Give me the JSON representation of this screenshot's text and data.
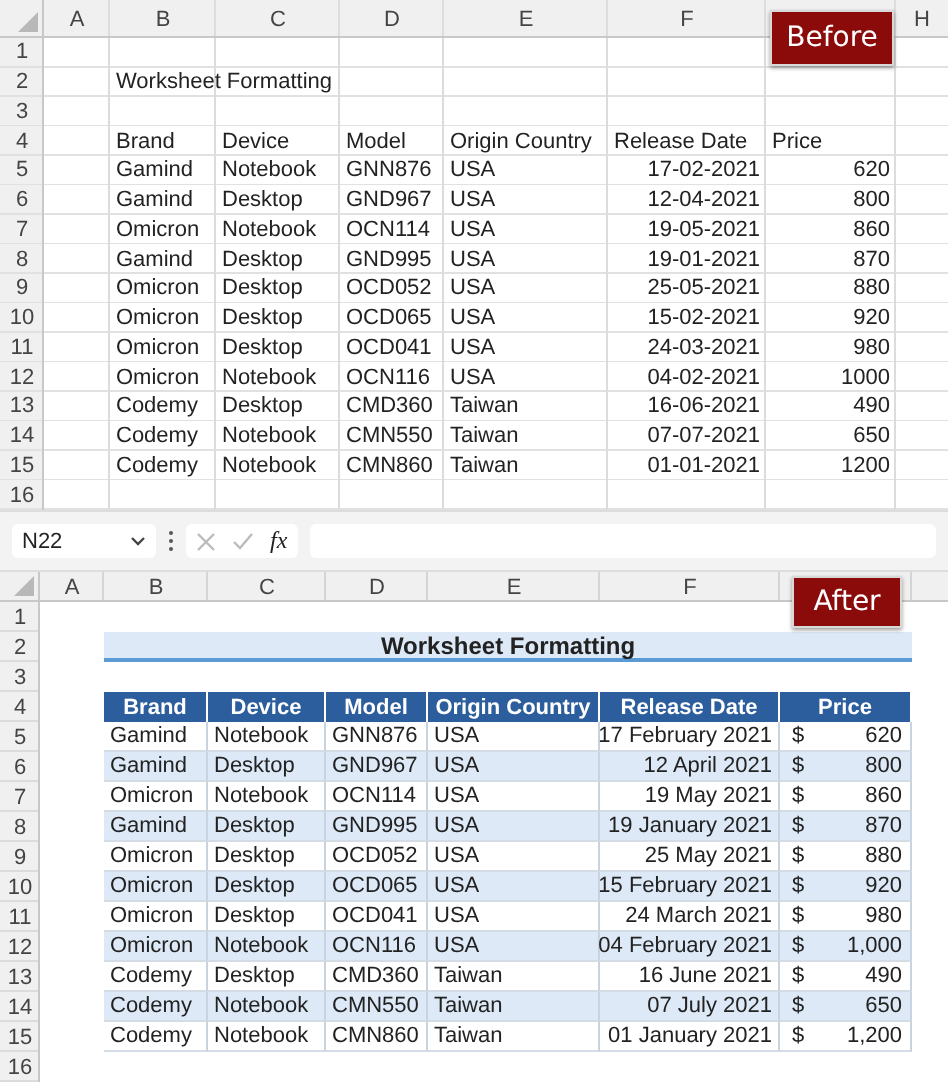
{
  "before": {
    "badge": "Before",
    "column_letters": [
      "A",
      "B",
      "C",
      "D",
      "E",
      "F",
      "H"
    ],
    "row_numbers": [
      "1",
      "2",
      "3",
      "4",
      "5",
      "6",
      "7",
      "8",
      "9",
      "10",
      "11",
      "12",
      "13",
      "14",
      "15",
      "16"
    ],
    "title": "Worksheet Formatting",
    "headers": [
      "Brand",
      "Device",
      "Model",
      "Origin Country",
      "Release Date",
      "Price"
    ],
    "rows": [
      [
        "Gamind",
        "Notebook",
        "GNN876",
        "USA",
        "17-02-2021",
        "620"
      ],
      [
        "Gamind",
        "Desktop",
        "GND967",
        "USA",
        "12-04-2021",
        "800"
      ],
      [
        "Omicron",
        "Notebook",
        "OCN114",
        "USA",
        "19-05-2021",
        "860"
      ],
      [
        "Gamind",
        "Desktop",
        "GND995",
        "USA",
        "19-01-2021",
        "870"
      ],
      [
        "Omicron",
        "Desktop",
        "OCD052",
        "USA",
        "25-05-2021",
        "880"
      ],
      [
        "Omicron",
        "Desktop",
        "OCD065",
        "USA",
        "15-02-2021",
        "920"
      ],
      [
        "Omicron",
        "Desktop",
        "OCD041",
        "USA",
        "24-03-2021",
        "980"
      ],
      [
        "Omicron",
        "Notebook",
        "OCN116",
        "USA",
        "04-02-2021",
        "1000"
      ],
      [
        "Codemy",
        "Desktop",
        "CMD360",
        "Taiwan",
        "16-06-2021",
        "490"
      ],
      [
        "Codemy",
        "Notebook",
        "CMN550",
        "Taiwan",
        "07-07-2021",
        "650"
      ],
      [
        "Codemy",
        "Notebook",
        "CMN860",
        "Taiwan",
        "01-01-2021",
        "1200"
      ]
    ]
  },
  "formula_bar": {
    "name_box": "N22",
    "function_label": "fx"
  },
  "after": {
    "badge": "After",
    "column_letters": [
      "A",
      "B",
      "C",
      "D",
      "E",
      "F"
    ],
    "row_numbers": [
      "1",
      "2",
      "3",
      "4",
      "5",
      "6",
      "7",
      "8",
      "9",
      "10",
      "11",
      "12",
      "13",
      "14",
      "15",
      "16"
    ],
    "title": "Worksheet Formatting",
    "headers": [
      "Brand",
      "Device",
      "Model",
      "Origin Country",
      "Release Date",
      "Price"
    ],
    "rows": [
      [
        "Gamind",
        "Notebook",
        "GNN876",
        "USA",
        "17 February 2021",
        {
          "currency": "$",
          "amount": "620"
        }
      ],
      [
        "Gamind",
        "Desktop",
        "GND967",
        "USA",
        "12 April 2021",
        {
          "currency": "$",
          "amount": "800"
        }
      ],
      [
        "Omicron",
        "Notebook",
        "OCN114",
        "USA",
        "19 May 2021",
        {
          "currency": "$",
          "amount": "860"
        }
      ],
      [
        "Gamind",
        "Desktop",
        "GND995",
        "USA",
        "19 January 2021",
        {
          "currency": "$",
          "amount": "870"
        }
      ],
      [
        "Omicron",
        "Desktop",
        "OCD052",
        "USA",
        "25 May 2021",
        {
          "currency": "$",
          "amount": "880"
        }
      ],
      [
        "Omicron",
        "Desktop",
        "OCD065",
        "USA",
        "15 February 2021",
        {
          "currency": "$",
          "amount": "920"
        }
      ],
      [
        "Omicron",
        "Desktop",
        "OCD041",
        "USA",
        "24 March 2021",
        {
          "currency": "$",
          "amount": "980"
        }
      ],
      [
        "Omicron",
        "Notebook",
        "OCN116",
        "USA",
        "04 February 2021",
        {
          "currency": "$",
          "amount": "1,000"
        }
      ],
      [
        "Codemy",
        "Desktop",
        "CMD360",
        "Taiwan",
        "16 June 2021",
        {
          "currency": "$",
          "amount": "490"
        }
      ],
      [
        "Codemy",
        "Notebook",
        "CMN550",
        "Taiwan",
        "07 July 2021",
        {
          "currency": "$",
          "amount": "650"
        }
      ],
      [
        "Codemy",
        "Notebook",
        "CMN860",
        "Taiwan",
        "01 January 2021",
        {
          "currency": "$",
          "amount": "1,200"
        }
      ]
    ]
  }
}
